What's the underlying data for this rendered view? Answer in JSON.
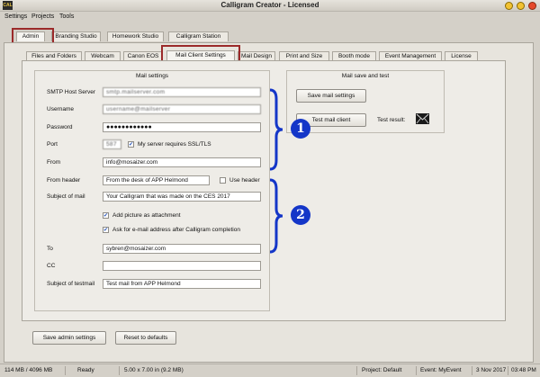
{
  "window": {
    "app_icon_text": "CAL",
    "title": "Calligram Creator - Licensed",
    "colors": {
      "min": "#f2c232",
      "max": "#f2c232",
      "close": "#e64a2c"
    }
  },
  "menu": {
    "settings": "Settings",
    "projects": "Projects",
    "tools": "Tools"
  },
  "top_tabs": {
    "admin": "Admin",
    "branding": "Branding Studio",
    "homework": "Homework Studio",
    "station": "Calligram Station"
  },
  "sub_tabs": {
    "files": "Files and Folders",
    "webcam": "Webcam",
    "canon": "Canon EOS",
    "mail_client": "Mail Client Settings",
    "mail_design": "Mail Design",
    "print": "Print and Size",
    "booth": "Booth mode",
    "event": "Event Management",
    "license": "License"
  },
  "mail_settings": {
    "title": "Mail settings",
    "smtp_label": "SMTP Host Server",
    "smtp_value": "smtp.mailserver.com",
    "username_label": "Username",
    "username_value": "username@mailserver",
    "password_label": "Password",
    "password_value": "●●●●●●●●●●●●",
    "port_label": "Port",
    "port_value": "587",
    "ssl_label": "My server requires SSL/TLS",
    "from_label": "From",
    "from_value": "info@mosaizer.com",
    "from_header_label": "From header",
    "from_header_value": "From the desk of APP Helmond",
    "use_header_label": "Use header",
    "subject_label": "Subject of mail",
    "subject_value": "Your Calligram that was made on the CES 2017",
    "add_picture_label": "Add picture as attachment",
    "ask_email_label": "Ask for e-mail address after Calligram completion",
    "to_label": "To",
    "to_value": "sybren@mosaizer.com",
    "cc_label": "CC",
    "cc_value": "",
    "subject_test_label": "Subject of testmail",
    "subject_test_value": "Test mail from APP Helmond"
  },
  "mail_test": {
    "title": "Mail save and test",
    "save_button": "Save mail settings",
    "test_button": "Test mail client",
    "result_label": "Test result:"
  },
  "callouts": {
    "one": "1",
    "two": "2"
  },
  "bottom_buttons": {
    "save_admin": "Save admin settings",
    "reset": "Reset to defaults"
  },
  "status": {
    "memory": "114 MB / 4096 MB",
    "state": "Ready",
    "size": "5.00 x 7.00 in  (9.2 MB)",
    "project": "Project: Default",
    "event": "Event: MyEvent",
    "date": "3 Nov 2017",
    "time": "03:48 PM"
  },
  "accent_colors": {
    "callout_blue": "#1436c8",
    "highlight_red": "#9b2a2a"
  }
}
